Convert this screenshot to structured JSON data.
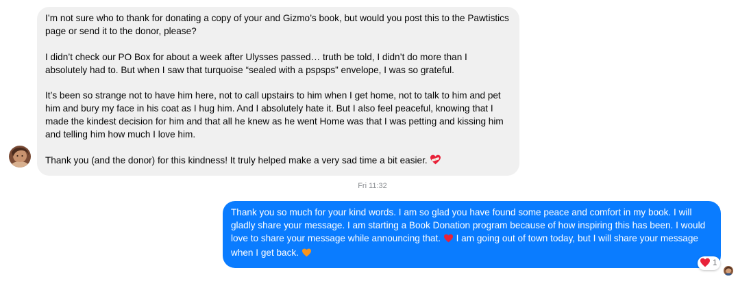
{
  "incoming_message": {
    "paragraphs": [
      "I’m not sure who to thank for donating a copy of your and Gizmo’s book, but would you post this to the Pawtistics page or send it to the donor, please?",
      "I didn’t check our PO Box for about a week after Ulysses passed… truth be told, I didn’t do more than I absolutely had to.  But when I saw that turquoise “sealed with a pspsps” envelope, I was so grateful.",
      "It’s been so strange not to have him here, not to call upstairs to him when I get home, not to talk to him and pet him and bury my face in his coat as I hug him.  And I absolutely hate it.  But I also feel peaceful, knowing that I made the kindest decision for him and that all he knew as he went Home was that I was petting and kissing him and telling him how much I love him."
    ],
    "closing": "Thank you (and the donor) for this kindness!  It truly helped make a very sad time a bit easier.",
    "closing_emoji": "heart-with-bandage-icon"
  },
  "timestamp": "Fri 11:32",
  "outgoing_message": {
    "part1": "Thank you so much for your kind words. I am so glad you have found some peace and comfort in my book. I will gladly share your message. I am starting a Book Donation program because of how inspiring this has been. I would love to share your message while announcing that.",
    "emoji1": "red-heart-icon",
    "part2": "I am going out of town today, but I will share your message when I get back.",
    "emoji2": "orange-heart-icon"
  },
  "reaction": {
    "emoji": "red-heart-icon",
    "count": "1"
  },
  "colors": {
    "outgoing_bubble": "#0a7cff",
    "incoming_bubble": "#f0f0f0",
    "red_heart": "#e8223a",
    "orange_heart": "#f7941d"
  }
}
